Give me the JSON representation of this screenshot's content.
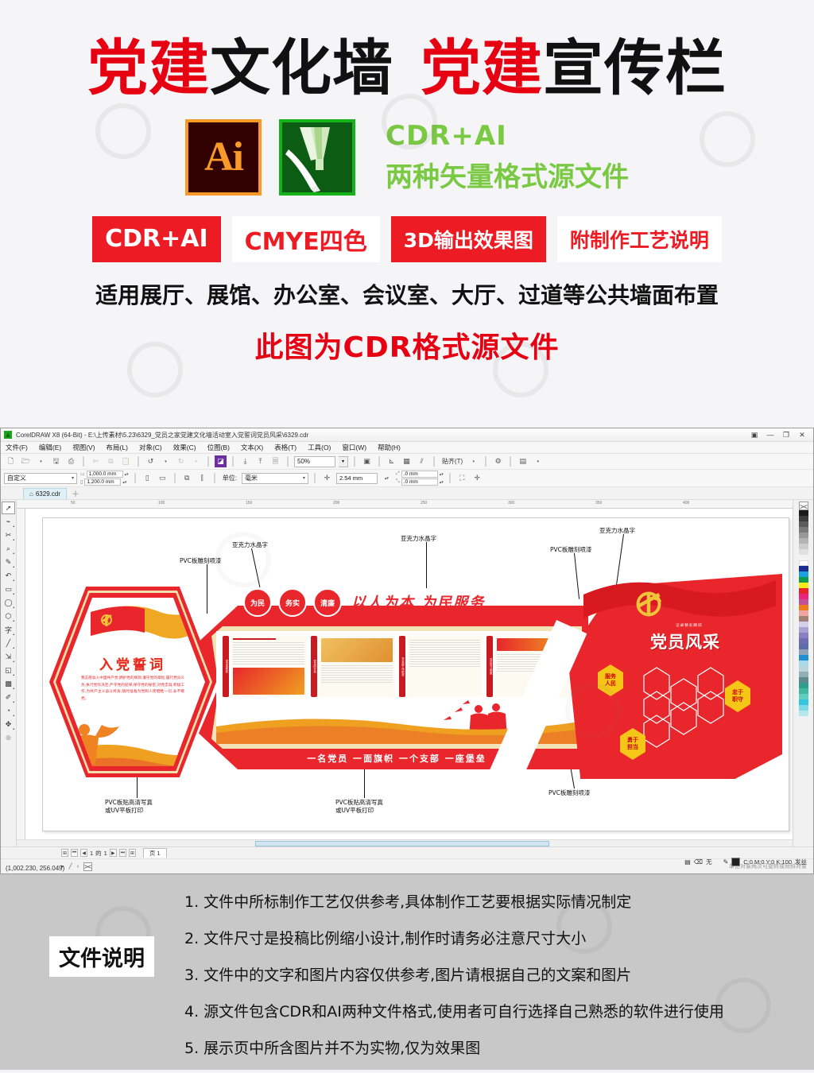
{
  "promo": {
    "title_parts": [
      {
        "text": "党建",
        "color": "red"
      },
      {
        "text": "文化墙",
        "color": "black"
      },
      {
        "text": "  ",
        "color": "black"
      },
      {
        "text": "党建",
        "color": "red"
      },
      {
        "text": "宣传栏",
        "color": "black"
      }
    ],
    "title_full": "党建文化墙 党建宣传栏",
    "ai_logo_label": "Ai",
    "cdr_logo_label": "CorelDRAW",
    "format_line1": "CDR+AI",
    "format_line2": "两种矢量格式源文件",
    "badges": [
      {
        "label": "CDR+AI",
        "style": "fill"
      },
      {
        "label": "CMYE四色",
        "style": "out"
      },
      {
        "label": "3D输出效果图",
        "style": "fill"
      },
      {
        "label": "附制作工艺说明",
        "style": "out"
      }
    ],
    "applies_to": "适用展厅、展馆、办公室、会议室、大厅、过道等公共墙面布置",
    "format_note": "此图为CDR格式源文件",
    "colors": {
      "red": "#e60012",
      "badge_red": "#ed1c24",
      "green": "#7ac943"
    }
  },
  "app": {
    "title": "CorelDRAW X8 (64-Bit) - E:\\上传素材\\5.23\\6329_党员之家党建文化墙活动室入党誓词党员风采\\6329.cdr",
    "window_buttons": [
      "restore",
      "minimize",
      "maximize",
      "close"
    ],
    "menu": [
      "文件(F)",
      "编辑(E)",
      "视图(V)",
      "布局(L)",
      "对象(C)",
      "效果(C)",
      "位图(B)",
      "文本(X)",
      "表格(T)",
      "工具(O)",
      "窗口(W)",
      "帮助(H)"
    ],
    "toolbar": {
      "zoom_level": "50%",
      "snap_label": "贴齐(T)",
      "icons": [
        "new-document-icon",
        "open-folder-icon",
        "save-icon",
        "print-icon",
        "cut-icon",
        "copy-icon",
        "paste-icon",
        "undo-icon",
        "redo-icon",
        "import-icon",
        "export-icon",
        "publish-pdf-icon",
        "fullscreen-icon",
        "show-rulers-icon",
        "grid-icon",
        "guides-icon",
        "options-icon",
        "application-launcher-icon"
      ]
    },
    "propertybar": {
      "preset": "自定义",
      "width": "1,000.0 mm",
      "height": "1,200.0 mm",
      "unit_label": "单位:",
      "unit_value": "毫米",
      "nudge": "2.54 mm",
      "duplicate_x": ".0 mm",
      "duplicate_y": ".0 mm"
    },
    "document_tab": "6329.cdr",
    "toolbox": [
      {
        "name": "pick-tool",
        "glyph": "➚",
        "active": true
      },
      {
        "name": "shape-tool",
        "glyph": "➣"
      },
      {
        "name": "crop-tool",
        "glyph": "✂"
      },
      {
        "name": "zoom-tool",
        "glyph": "⌕"
      },
      {
        "name": "freehand-tool",
        "glyph": "✎"
      },
      {
        "name": "smart-fill-tool",
        "glyph": "✑"
      },
      {
        "name": "rectangle-tool",
        "glyph": "▭"
      },
      {
        "name": "ellipse-tool",
        "glyph": "◯"
      },
      {
        "name": "polygon-tool",
        "glyph": "⬡"
      },
      {
        "name": "text-tool",
        "glyph": "字"
      },
      {
        "name": "parallel-dimension-tool",
        "glyph": "╱"
      },
      {
        "name": "straight-line-connector-tool",
        "glyph": "⇲"
      },
      {
        "name": "drop-shadow-tool",
        "glyph": "◱"
      },
      {
        "name": "transparency-tool",
        "glyph": "▩"
      },
      {
        "name": "color-eyedropper-tool",
        "glyph": "✐"
      },
      {
        "name": "interactive-fill-tool",
        "glyph": "◔"
      },
      {
        "name": "smart-drawing-tool",
        "glyph": "✥"
      },
      {
        "name": "outline-tool",
        "glyph": "⊕"
      }
    ],
    "statusbar": {
      "page_current": "1",
      "page_of": "的",
      "page_total": "1",
      "page_tab": "页 1",
      "hint": "单击对象两次可旋转或倾斜对象",
      "coordinates": "(1,002.230, 256.049)",
      "fill_none": "无",
      "outline_color": "C:0 M:0 Y:0 K:100",
      "outline_width": "发丝"
    },
    "palette_colors": [
      "#ffffff",
      "#1a1a1a",
      "#3d3d3d",
      "#5c5c5c",
      "#7a7a7a",
      "#999999",
      "#b3b3b3",
      "#cccccc",
      "#e0e0e0",
      "#f2f2f2",
      "#ffffff",
      "#1b2c8f",
      "#1ba0e0",
      "#0f9b4a",
      "#f4ec1c",
      "#e8232a",
      "#e8247c",
      "#c0519b",
      "#f07d1a",
      "#f0a6a0",
      "#a08274",
      "#d4d0ea",
      "#a9a0d4",
      "#8b7fc4",
      "#6f6fb0",
      "#5a6ea8",
      "#8fa3b8",
      "#1e8fd0",
      "#a8d8ea",
      "#bcd4d8",
      "#92b0b4",
      "#5f8a8d",
      "#2f9e8f",
      "#3fb8a0",
      "#5fd0c0",
      "#35c5e0",
      "#7fd8e8",
      "#b6e6ea"
    ]
  },
  "artwork": {
    "callouts": [
      {
        "text": "PVC板雕刻喷漆",
        "id": "callout-pvc-carve-left"
      },
      {
        "text": "亚克力水晶字",
        "id": "callout-acrylic-left"
      },
      {
        "text": "亚克力水晶字",
        "id": "callout-acrylic-center"
      },
      {
        "text": "亚克力水晶字",
        "id": "callout-acrylic-right"
      },
      {
        "text": "PVC板雕刻喷漆",
        "id": "callout-pvc-carve-right"
      },
      {
        "text": "PVC板贴高清写真",
        "id": "callout-pvc-print-left-1"
      },
      {
        "text": "或UV平板打印",
        "id": "callout-pvc-print-left-2"
      },
      {
        "text": "PVC板贴高清写真",
        "id": "callout-pvc-print-center-1"
      },
      {
        "text": "或UV平板打印",
        "id": "callout-pvc-print-center-2"
      },
      {
        "text": "PVC板雕刻喷漆",
        "id": "callout-pvc-carve-bottom"
      }
    ],
    "oath_title": "入党誓词",
    "oath_text": "我志愿加入中国共产党,拥护党的纲领,遵守党的章程,履行党员义务,执行党的决定,严守党的纪律,保守党的秘密,对党忠诚,积极工作,为共产主义奋斗终身,随时准备为党和人民牺牲一切,永不叛党。",
    "circle_labels": [
      "为民",
      "务实",
      "清廉"
    ],
    "headline": "以人为本  为民服务",
    "bottom_slogan": "一名党员  一面旗帜  一个支部  一座堡垒",
    "right_panel": {
      "sub": "记录精彩瞬间",
      "title": "党员风采",
      "hex_labels": [
        "服务人民",
        "忠于职守",
        "勇于担当"
      ]
    },
    "column_tabs": [
      "党员的权利",
      "党员的义务",
      "党支部工作职责",
      "党员学习制度"
    ]
  },
  "footer": {
    "heading": "文件说明",
    "notes": [
      "1. 文件中所标制作工艺仅供参考,具体制作工艺要根据实际情况制定",
      "2. 文件尺寸是投稿比例缩小设计,制作时请务必注意尺寸大小",
      "3. 文件中的文字和图片内容仅供参考,图片请根据自己的文案和图片",
      "4. 源文件包含CDR和AI两种文件格式,使用者可自行选择自己熟悉的软件进行使用",
      "5. 展示页中所含图片并不为实物,仅为效果图"
    ]
  }
}
